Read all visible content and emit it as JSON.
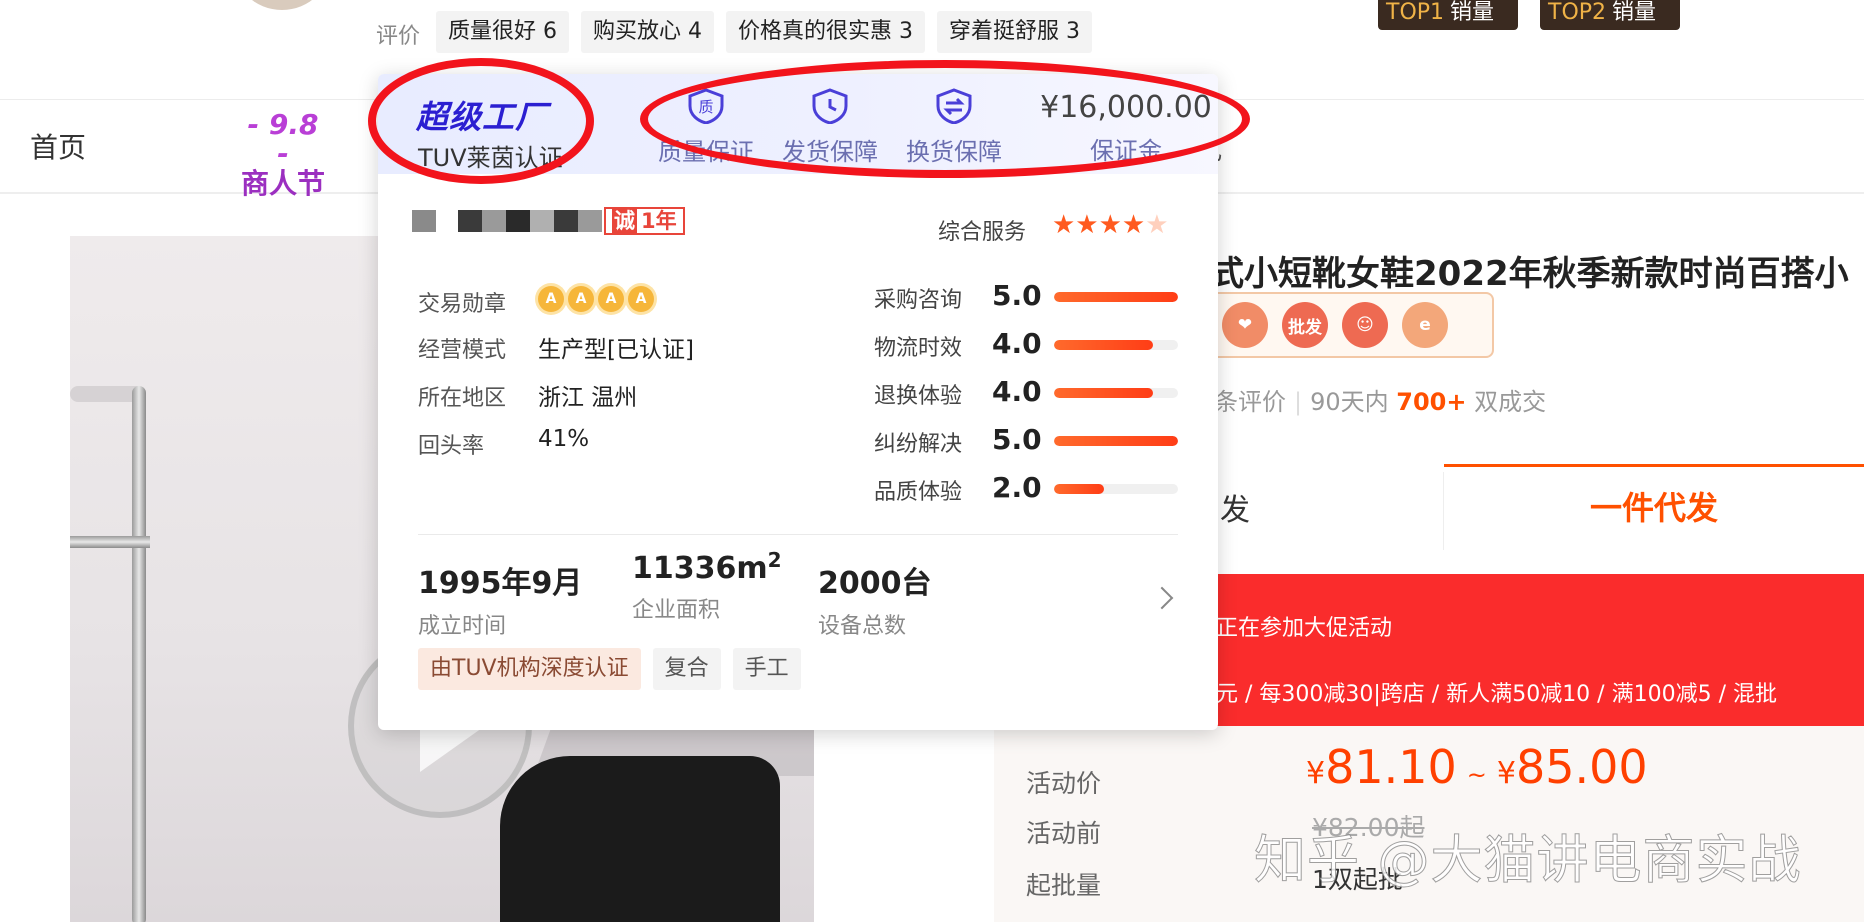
{
  "reviews": {
    "label": "评价",
    "tags": [
      "质量很好 6",
      "购买放心 4",
      "价格真的很实惠 3",
      "穿着挺舒服 3"
    ]
  },
  "rank_badges": [
    {
      "rank": "TOP1",
      "text": "销量"
    },
    {
      "rank": "TOP2",
      "text": "销量"
    }
  ],
  "nav": {
    "home": "首页",
    "promo": {
      "line1": "- 9.8 -",
      "line2": "商人节"
    },
    "partial": "式"
  },
  "card": {
    "factory_title": "超级工厂",
    "factory_sub": "TUV莱茵认证",
    "guarantees": [
      {
        "icon": "quality-icon",
        "label": "质量保证"
      },
      {
        "icon": "clock-icon",
        "label": "发货保障"
      },
      {
        "icon": "exchange-icon",
        "label": "换货保障"
      }
    ],
    "deposit": {
      "amount": "¥16,000.00",
      "label": "保证金"
    },
    "years_badge": {
      "prefix": "诚",
      "text": "1年"
    },
    "service_label": "综合服务",
    "service_stars": "★★★★★",
    "service_rating": 4.5,
    "medal_label": "交易勋章",
    "medals": [
      "A",
      "A",
      "A",
      "A"
    ],
    "info": [
      {
        "label": "经营模式",
        "value": "生产型[已认证]"
      },
      {
        "label": "所在地区",
        "value": "浙江 温州"
      },
      {
        "label": "回头率",
        "value": "41%"
      }
    ],
    "scores": [
      {
        "label": "采购咨询",
        "value": "5.0"
      },
      {
        "label": "物流时效",
        "value": "4.0"
      },
      {
        "label": "退换体验",
        "value": "4.0"
      },
      {
        "label": "纠纷解决",
        "value": "5.0"
      },
      {
        "label": "品质体验",
        "value": "2.0"
      }
    ],
    "facts": [
      {
        "value": "1995年9月",
        "label": "成立时间"
      },
      {
        "value": "11336m",
        "sup": "2",
        "label": "企业面积"
      },
      {
        "value": "2000台",
        "label": "设备总数"
      }
    ],
    "chips": [
      "由TUV机构深度认证",
      "复合",
      "手工"
    ]
  },
  "product": {
    "title_partial": "式小短靴女鞋2022年秋季新款时尚百搭小",
    "badge_icons": [
      "gift-icon",
      "wholesale-icon",
      "smile-icon",
      "alibaba-icon"
    ],
    "badge_text": "批发",
    "stats": {
      "reviews": "条评价",
      "period": "90天内",
      "count": "700+",
      "deals": "双成交"
    },
    "tab_left": "发",
    "tab_right": "一件代发",
    "promo_line1": "正在参加大促活动",
    "promo_line2": "元 / 每300减30|跨店 / 新人满50减10 / 满100减5 / 混批",
    "price_label": "活动价",
    "price_low": "81.10",
    "price_high": "85.00",
    "currency": "¥",
    "tilde": "~",
    "before_label": "活动前",
    "before_value": "¥82.00起",
    "moq_label": "起批量",
    "moq_value": "1双起批",
    "watermark": "知乎 @大猫讲电商实战"
  },
  "colors": {
    "accent": "#ff5000",
    "annotation": "#f2141c",
    "factory": "#2b1fd1",
    "promo_band": "#fa2c2c"
  }
}
